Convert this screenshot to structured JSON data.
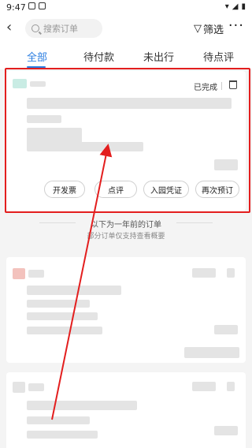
{
  "status_bar": {
    "time": "9:47"
  },
  "header": {
    "search_placeholder": "搜索订单",
    "filter_label": "筛选",
    "more_label": "···"
  },
  "tabs": [
    {
      "label": "全部"
    },
    {
      "label": "待付款"
    },
    {
      "label": "未出行"
    },
    {
      "label": "待点评"
    }
  ],
  "order": {
    "status": "已完成",
    "actions": [
      {
        "label": "开发票"
      },
      {
        "label": "点评"
      },
      {
        "label": "入园凭证"
      },
      {
        "label": "再次预订"
      }
    ]
  },
  "divider": {
    "title": "以下为一年前的订单",
    "subtitle": "部分订单仅支持查看概要"
  },
  "colors": {
    "accent": "#2a7de1",
    "highlight": "#e31e1e"
  }
}
